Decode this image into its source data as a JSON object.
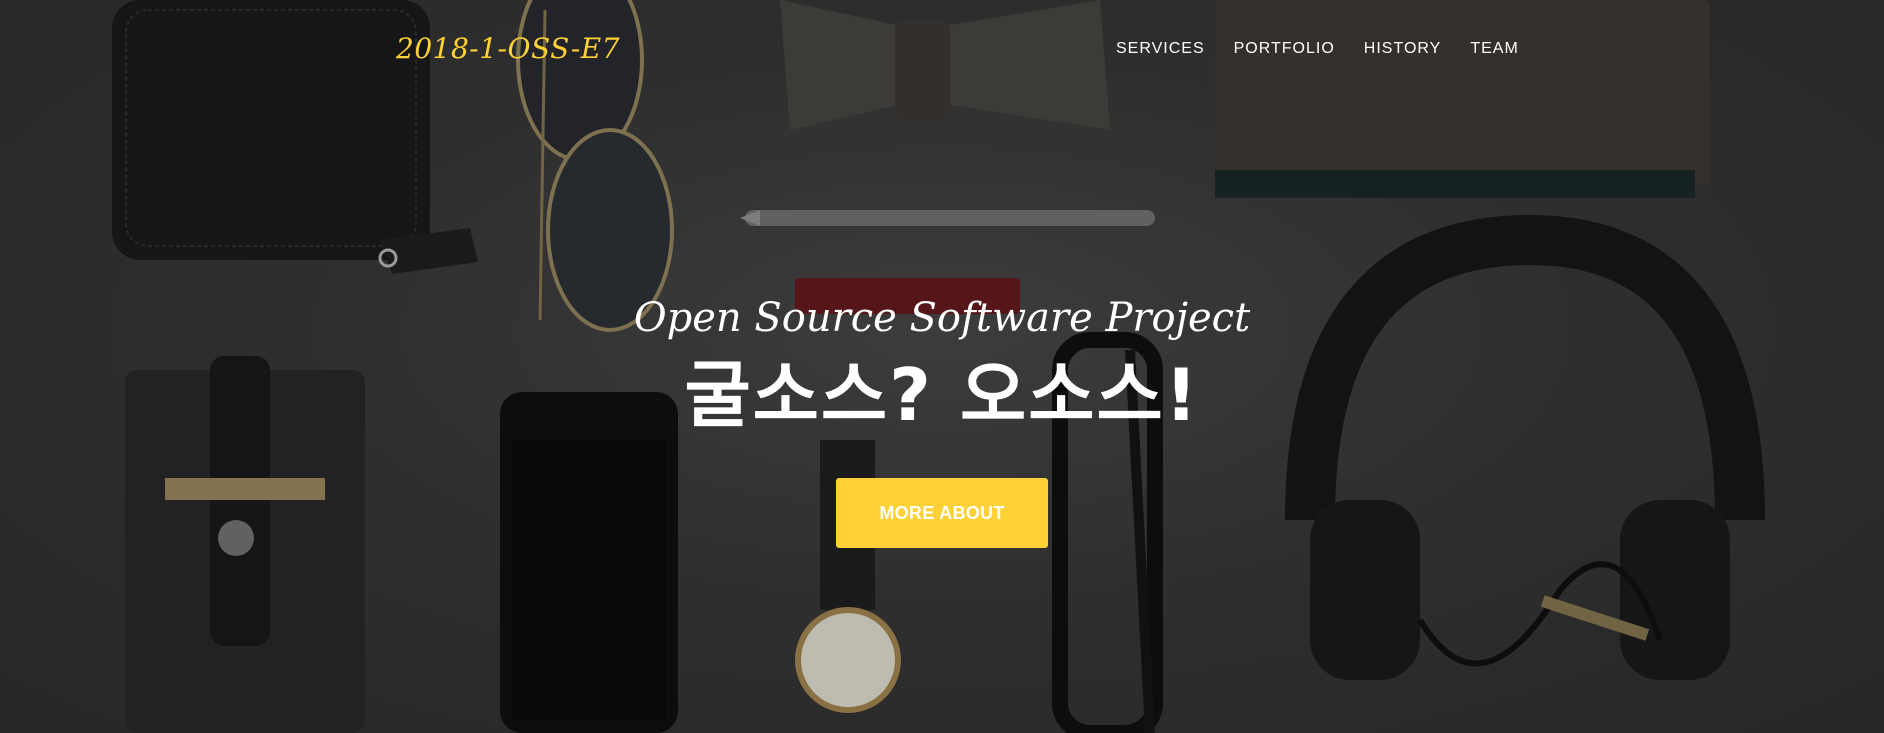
{
  "nav": {
    "brand": "2018-1-OSS-E7",
    "items": [
      {
        "label": "SERVICES"
      },
      {
        "label": "PORTFOLIO"
      },
      {
        "label": "HISTORY"
      },
      {
        "label": "TEAM"
      }
    ]
  },
  "intro": {
    "lead_in": "Open Source Software Project",
    "heading": "굴소스? 오소스!",
    "button_label": "MORE ABOUT"
  },
  "colors": {
    "accent": "#fed136",
    "text": "#ffffff",
    "background": "#3b3b3b"
  }
}
